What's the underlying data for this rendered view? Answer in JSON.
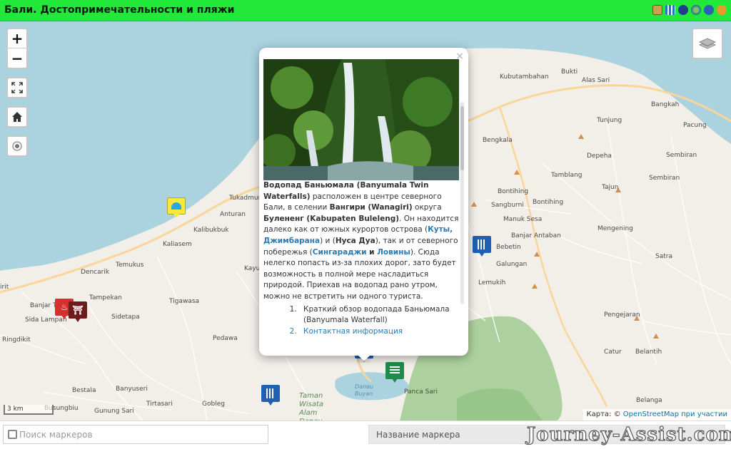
{
  "header": {
    "title": "Бали. Достопримечательности и пляжи",
    "share_icons": [
      "camera-icon",
      "qr-icon",
      "network-icon",
      "globe-icon",
      "save-icon",
      "help-icon"
    ]
  },
  "map": {
    "controls": {
      "zoom_in": "+",
      "zoom_out": "−",
      "fullscreen_icon": "fullscreen-icon",
      "home_icon": "home-icon",
      "locate_icon": "locate-icon",
      "layers_icon": "layers-icon"
    },
    "labels": [
      {
        "text": "Kubutambahan",
        "kind": "town"
      },
      {
        "text": "Bukti",
        "kind": "town"
      },
      {
        "text": "Alas Sari",
        "kind": "town"
      },
      {
        "text": "Bangkah",
        "kind": "town"
      },
      {
        "text": "Tunjung",
        "kind": "town"
      },
      {
        "text": "Pacung",
        "kind": "town"
      },
      {
        "text": "Bengkala",
        "kind": "town"
      },
      {
        "text": "Depeha",
        "kind": "town"
      },
      {
        "text": "Sembiran",
        "kind": "town"
      },
      {
        "text": "Tamblang",
        "kind": "town"
      },
      {
        "text": "Sembiran",
        "kind": "town"
      },
      {
        "text": "Bontihing",
        "kind": "town"
      },
      {
        "text": "Tajun",
        "kind": "town"
      },
      {
        "text": "Sangburni",
        "kind": "town"
      },
      {
        "text": "Bontihing",
        "kind": "town"
      },
      {
        "text": "Manuk Sesa",
        "kind": "town"
      },
      {
        "text": "Mengening",
        "kind": "town"
      },
      {
        "text": "Banjar Antaban",
        "kind": "town"
      },
      {
        "text": "Bebetin",
        "kind": "town"
      },
      {
        "text": "Galungan",
        "kind": "town"
      },
      {
        "text": "Satra",
        "kind": "town"
      },
      {
        "text": "Lemukih",
        "kind": "town"
      },
      {
        "text": "Pengejaran",
        "kind": "town"
      },
      {
        "text": "Catur",
        "kind": "town"
      },
      {
        "text": "Belantih",
        "kind": "town"
      },
      {
        "text": "Belanga",
        "kind": "town"
      },
      {
        "text": "Tukadmur",
        "kind": "town"
      },
      {
        "text": "Anturan",
        "kind": "town"
      },
      {
        "text": "Kalibukbuk",
        "kind": "town"
      },
      {
        "text": "Kaliasem",
        "kind": "town"
      },
      {
        "text": "Temukus",
        "kind": "town"
      },
      {
        "text": "Dencarik",
        "kind": "town"
      },
      {
        "text": "Kayu",
        "kind": "town"
      },
      {
        "text": "Tampekan",
        "kind": "town"
      },
      {
        "text": "Banjar Ta",
        "kind": "town"
      },
      {
        "text": "Sida Lampah",
        "kind": "town"
      },
      {
        "text": "Sidetapa",
        "kind": "town"
      },
      {
        "text": "Tigawasa",
        "kind": "town"
      },
      {
        "text": "Ringdikit",
        "kind": "town"
      },
      {
        "text": "Pedawa",
        "kind": "town"
      },
      {
        "text": "Bestala",
        "kind": "town"
      },
      {
        "text": "Banyuseri",
        "kind": "town"
      },
      {
        "text": "Gunung Sari",
        "kind": "town"
      },
      {
        "text": "Tirtasari",
        "kind": "town"
      },
      {
        "text": "Gobleg",
        "kind": "town"
      },
      {
        "text": "Busungbiu",
        "kind": "town"
      },
      {
        "text": "Panca Sari",
        "kind": "town"
      },
      {
        "text": "Danau Buyan",
        "kind": "water"
      },
      {
        "text": "Taman Wisata Alam Danau",
        "kind": "park"
      },
      {
        "text": "irit",
        "kind": "town"
      }
    ],
    "popup": {
      "title": "Водопад Баньюмала (Banyumala Twin Waterfalls)",
      "text_1": " расположен в центре северного Бали, в селении ",
      "village": "Вангири (Wanagiri)",
      "text_2": " округа ",
      "district": "Буленeнг (Kabupaten Buleleng)",
      "text_3": ". Он находится далеко как от южных курортов острова (",
      "link_1": "Куты, Джимбарана",
      "text_4": ") и (",
      "link_2": "Нуса Дуа",
      "text_5": "), так и от северного побережья (",
      "link_3": "Сингараджи",
      "text_6": " и ",
      "link_4": "Ловины",
      "text_7": "). Сюда нелегко попасть из-за плохих дорог, зато будет возможность в полной мере насладиться природой. Приехав на водопад рано утром, можно не встретить ни одного туриста.",
      "list": [
        "Краткий обзор водопада Баньюмала (Banyumala Waterfall)",
        "Контактная информация"
      ],
      "close": "×"
    },
    "scale_label": "3 km",
    "attribution_prefix": "Карта: © ",
    "attribution_link": "OpenStreetMap",
    "attribution_suffix": " при участии",
    "colors": {
      "land": "#f2efe9",
      "sea": "#aad3df",
      "forest": "#add19e",
      "road_major": "#f9d59a",
      "road_minor": "#ffffff",
      "marker_waterfall": "#1f5fb4",
      "marker_beach": "#f7e840",
      "marker_spa": "#d62f2f",
      "marker_temple": "#6e1b1b",
      "marker_lake": "#1f8a4a"
    }
  },
  "bottom": {
    "search_placeholder": "Поиск маркеров",
    "marker_name_label": "Название маркера",
    "watermark": "Journey-Assist.com"
  }
}
